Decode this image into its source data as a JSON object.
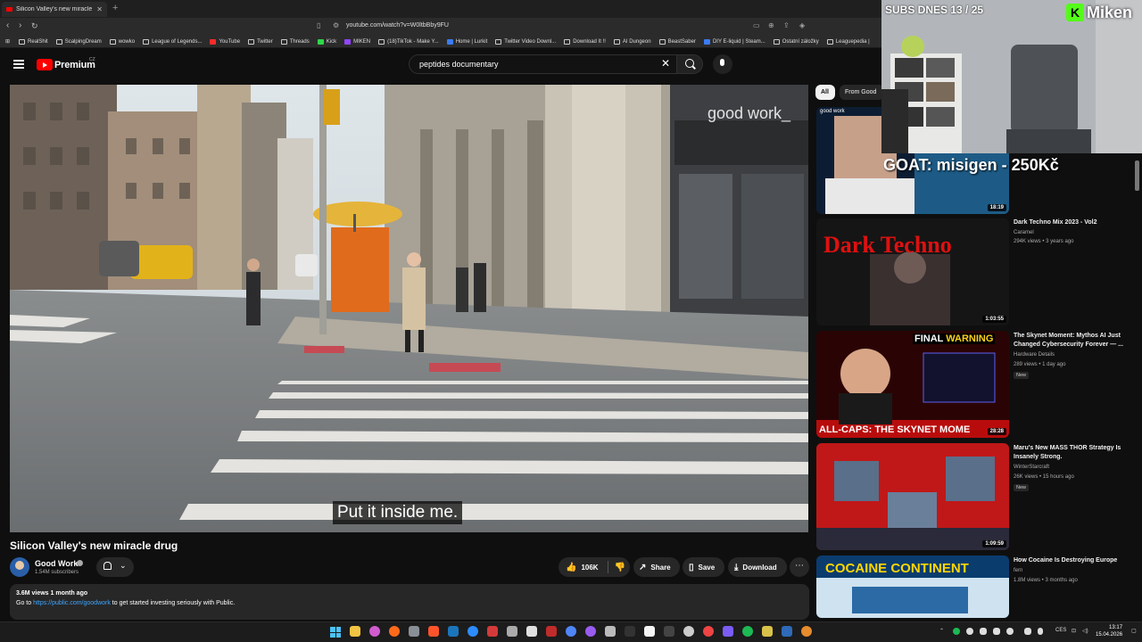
{
  "browser": {
    "tab_title": "Silicon Valley's new miracle drug",
    "tab_close": "✕",
    "new_tab": "+",
    "url": "youtube.com/watch?v=W0ltbBby9FU",
    "bookmarks": [
      {
        "label": "RealShit",
        "icon": "folder"
      },
      {
        "label": "ScalpingDream",
        "icon": "folder"
      },
      {
        "label": "wowko",
        "icon": "folder"
      },
      {
        "label": "League of Legends...",
        "icon": "folder"
      },
      {
        "label": "YouTube",
        "icon": "red"
      },
      {
        "label": "Twitter",
        "icon": "folder"
      },
      {
        "label": "Threads",
        "icon": "folder"
      },
      {
        "label": "Kick",
        "icon": "green"
      },
      {
        "label": "MIKEN",
        "icon": "purple"
      },
      {
        "label": "(18)TikTok - Make Y...",
        "icon": "folder"
      },
      {
        "label": "Home | Lurkit",
        "icon": "blue"
      },
      {
        "label": "Twitter Video Downl...",
        "icon": "folder"
      },
      {
        "label": "Download It !!",
        "icon": "folder"
      },
      {
        "label": "AI Dungeon",
        "icon": "folder"
      },
      {
        "label": "BeastSaber",
        "icon": "folder"
      },
      {
        "label": "DIY E-liquid | Steam...",
        "icon": "blue"
      },
      {
        "label": "Ostatní záložky",
        "icon": "folder"
      },
      {
        "label": "Leaguepedia |",
        "icon": "folder"
      }
    ]
  },
  "yt_header": {
    "logo_text": "Premium",
    "region": "CZ",
    "search_value": "peptides documentary"
  },
  "video": {
    "watermark": "good work_",
    "caption": "Put it inside me.",
    "title": "Silicon Valley's new miracle drug",
    "channel": "Good Work",
    "subscribers": "1.54M subscribers",
    "likes": "106K",
    "share_label": "Share",
    "save_label": "Save",
    "download_label": "Download",
    "more_label": "⋯",
    "views_date": "3.6M views  1 month ago",
    "desc_prefix": "Go to ",
    "desc_link": "https://public.com/goodwork",
    "desc_suffix": " to get started investing seriously with Public."
  },
  "chips": [
    "All",
    "From Good"
  ],
  "recommendations": [
    {
      "title": "",
      "channel": "",
      "meta": "",
      "duration": "18:19",
      "badge": "",
      "thumb_colors": [
        "#0d2a4a",
        "#1e5a8a"
      ]
    },
    {
      "title": "Dark Techno Mix 2023 - Vol2",
      "channel": "Caramel",
      "meta": "294K views • 3 years ago",
      "duration": "1:03:55",
      "badge": "",
      "thumb_colors": [
        "#1a0a0a",
        "#3a1a1a"
      ]
    },
    {
      "title": "The Skynet Moment: Mythos AI Just Changed Cybersecurity Forever — ...",
      "channel": "Hardware Details",
      "meta": "289 views • 1 day ago",
      "duration": "28:28",
      "badge": "New",
      "thumb_colors": [
        "#2a0505",
        "#6a0a0a"
      ]
    },
    {
      "title": "Maru's New MASS THOR Strategy Is Insanely Strong.",
      "channel": "WinterStarcraft",
      "meta": "26K views • 15 hours ago",
      "duration": "1:09:59",
      "badge": "New",
      "thumb_colors": [
        "#a01010",
        "#d82020"
      ]
    },
    {
      "title": "How Cocaine Is Destroying Europe",
      "channel": "fern",
      "meta": "1.8M views • 3 months ago",
      "duration": "",
      "badge": "",
      "thumb_colors": [
        "#0a3a6a",
        "#cfe6f5"
      ]
    }
  ],
  "thumb_text": {
    "final_warning_1": "FINAL ",
    "final_warning_2": "WARNING",
    "all_caps": "ALL-CAPS: THE SKYNET MOME",
    "dark_techno": "Dark Techno",
    "cocaine": "COCAINE CONTINENT",
    "good_work_small": "good work"
  },
  "overlay": {
    "subs_text": "SUBS DNES 13 / 25",
    "kick_letter": "K",
    "streamer": "Miken",
    "goat_text": "GOAT: misigen - 250Kč"
  },
  "taskbar": {
    "lang": "CES",
    "time": "13:17",
    "date": "15.04.2026"
  },
  "colors": {
    "yt_red": "#ff0000",
    "link_blue": "#3ea6ff",
    "kick_green": "#53fc18",
    "windows_blue": "#4cc2ff"
  }
}
